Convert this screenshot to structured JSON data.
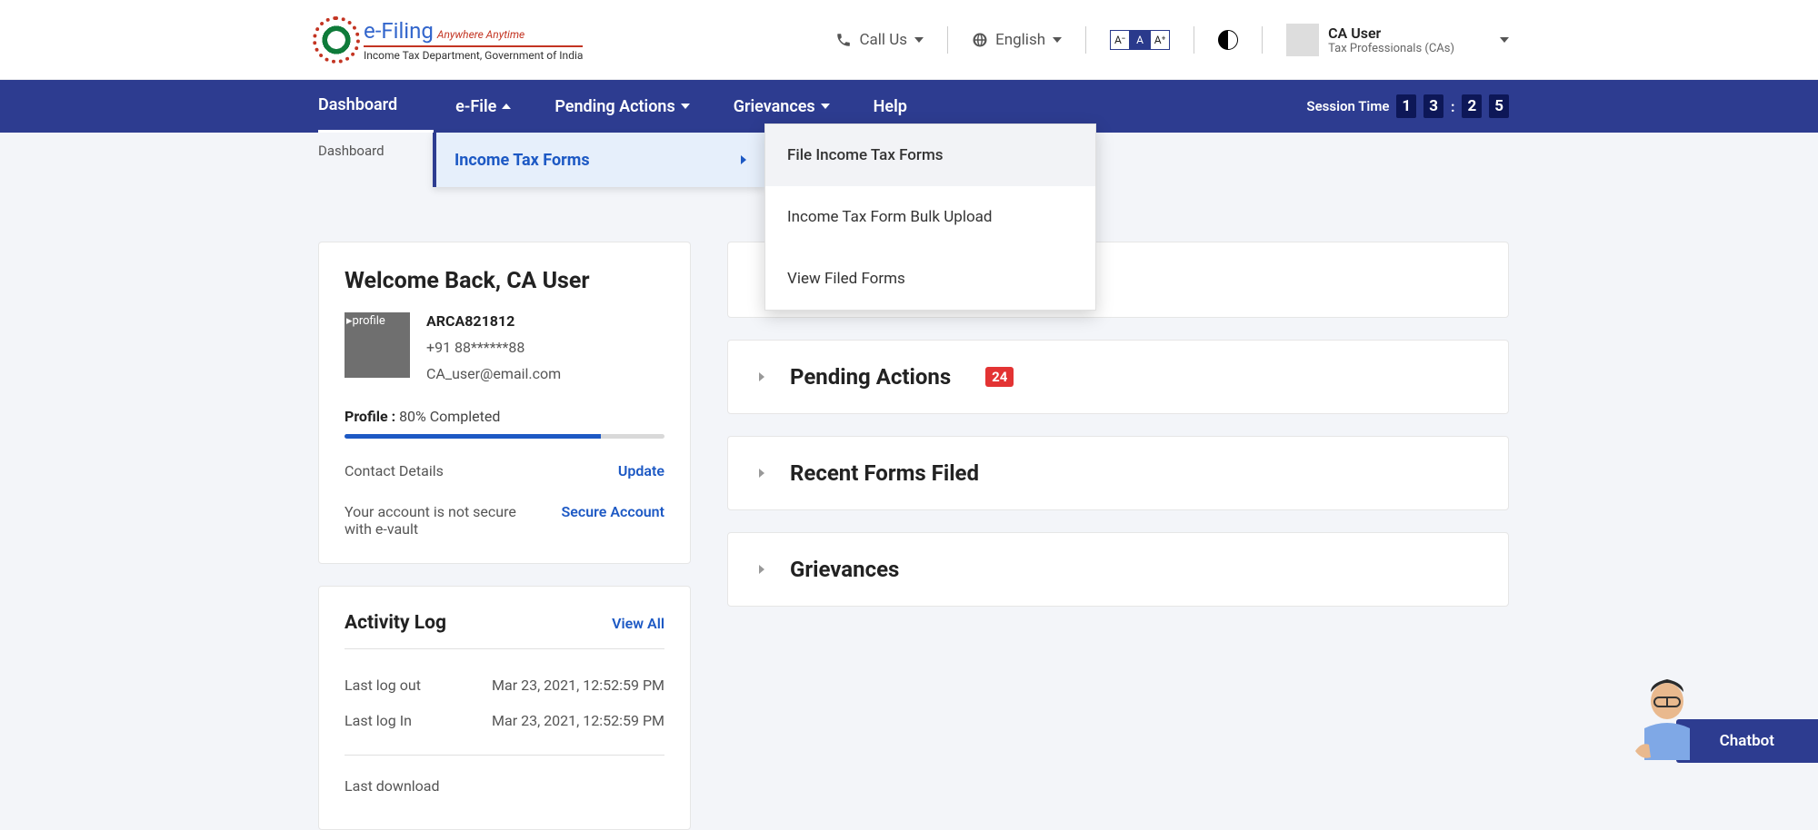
{
  "logo": {
    "title": "e-Filing",
    "tagline": "Anywhere Anytime",
    "subtitle": "Income Tax Department, Government of India"
  },
  "top": {
    "call_us": "Call Us",
    "language": "English",
    "text_small": "A⁻",
    "text_normal": "A",
    "text_large": "A⁺",
    "user_name": "CA User",
    "user_role": "Tax Professionals (CAs)"
  },
  "nav": {
    "dashboard": "Dashboard",
    "efile": "e-File",
    "pending": "Pending Actions",
    "grievances": "Grievances",
    "help": "Help",
    "session_label": "Session Time",
    "timer_m1": "1",
    "timer_m2": "3",
    "timer_s1": "2",
    "timer_s2": "5"
  },
  "breadcrumb": "Dashboard",
  "submenu": {
    "income_tax_forms": "Income Tax Forms",
    "flyout": {
      "file_forms": "File Income Tax Forms",
      "bulk_upload": "Income Tax Form Bulk Upload",
      "view_filed": "View Filed Forms"
    }
  },
  "profile": {
    "welcome_prefix": "Welcome Back, ",
    "welcome_name": "CA User",
    "img_alt": "profile",
    "id": "ARCA821812",
    "phone": "+91  88******88",
    "email": "CA_user@email.com",
    "profile_label": "Profile : ",
    "profile_value": "80% Completed",
    "progress_pct": 80,
    "contact_label": "Contact Details",
    "update_link": "Update",
    "secure_note": "Your account is not secure with e-vault",
    "secure_link": "Secure Account"
  },
  "activity": {
    "title": "Activity Log",
    "view_all": "View All",
    "rows": [
      {
        "label": "Last log out",
        "value": "Mar 23, 2021, 12:52:59 PM"
      },
      {
        "label": "Last log In",
        "value": "Mar 23, 2021, 12:52:59 PM"
      }
    ],
    "last_download_label": "Last download"
  },
  "accordions": {
    "pending_actions": "Pending Actions",
    "pending_badge": "24",
    "recent_forms": "Recent Forms Filed",
    "grievances": "Grievances"
  },
  "chatbot": "Chatbot"
}
